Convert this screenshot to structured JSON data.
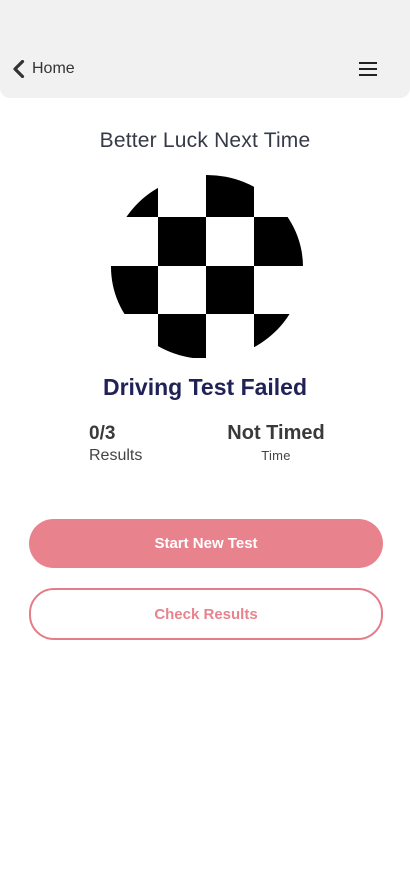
{
  "header": {
    "back_label": "Home",
    "back_icon": "chevron-left-icon",
    "menu_icon": "hamburger-menu-icon"
  },
  "result": {
    "heading": "Better Luck Next Time",
    "image_icon": "checkered-flag-icon",
    "status": "Driving Test Failed",
    "score": {
      "value": "0/3",
      "label": "Results"
    },
    "time": {
      "value": "Not Timed",
      "label": "Time"
    }
  },
  "actions": {
    "start_new_test": "Start New Test",
    "check_results": "Check Results"
  },
  "colors": {
    "header_bg": "#f1f1f1",
    "title_color": "#1f2157",
    "accent": "#e8838e",
    "text": "#363a47"
  }
}
